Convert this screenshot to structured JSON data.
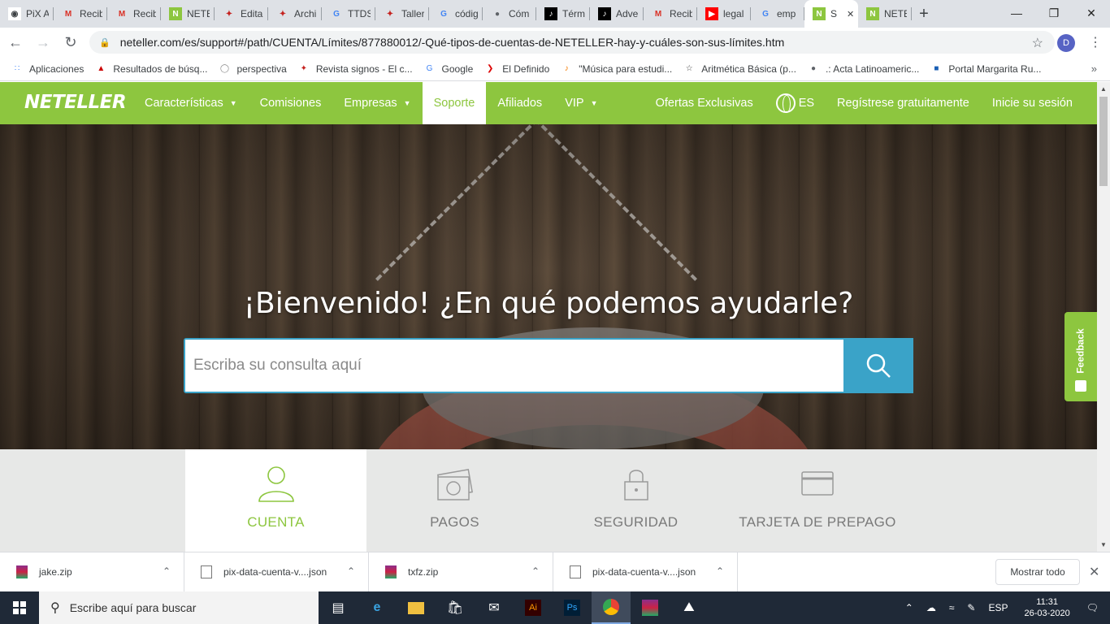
{
  "browser": {
    "tabs": [
      {
        "title": "PiX A",
        "icon": "pix-icon",
        "active": false
      },
      {
        "title": "Recib",
        "icon": "gmail-icon",
        "active": false
      },
      {
        "title": "Recib",
        "icon": "gmail-icon",
        "active": false
      },
      {
        "title": "NETE",
        "icon": "neteller-icon",
        "active": false
      },
      {
        "title": "Edita",
        "icon": "bird-icon",
        "active": false
      },
      {
        "title": "Archi",
        "icon": "bird-icon",
        "active": false
      },
      {
        "title": "TTDS",
        "icon": "google-icon",
        "active": false
      },
      {
        "title": "Taller",
        "icon": "bird-icon",
        "active": false
      },
      {
        "title": "códig",
        "icon": "google-icon",
        "active": false
      },
      {
        "title": "Cóm",
        "icon": "globe-icon",
        "active": false
      },
      {
        "title": "Térm",
        "icon": "tiktok-icon",
        "active": false
      },
      {
        "title": "Adve",
        "icon": "tiktok-icon",
        "active": false
      },
      {
        "title": "Recib",
        "icon": "gmail-icon",
        "active": false
      },
      {
        "title": "legal",
        "icon": "youtube-icon",
        "active": false
      },
      {
        "title": "emp",
        "icon": "google-icon",
        "active": false
      },
      {
        "title": "S",
        "icon": "neteller-icon",
        "active": true
      },
      {
        "title": "NETE",
        "icon": "neteller-icon",
        "active": false
      }
    ],
    "url": "neteller.com/es/support#/path/CUENTA/Límites/877880012/-Qué-tipos-de-cuentas-de-NETELLER-hay-y-cuáles-son-sus-límites.htm",
    "profile_initial": "D",
    "bookmarks": [
      {
        "label": "Aplicaciones",
        "icon": "apps-grid-icon"
      },
      {
        "label": "Resultados de búsq...",
        "icon": "adobe-icon"
      },
      {
        "label": "perspectiva",
        "icon": "bulb-icon"
      },
      {
        "label": "Revista signos - El c...",
        "icon": "bird-icon"
      },
      {
        "label": "Google",
        "icon": "google-icon"
      },
      {
        "label": "El Definido",
        "icon": "arrow-icon"
      },
      {
        "label": "\"Música para estudi...",
        "icon": "music-icon"
      },
      {
        "label": "Aritmética Básica (p...",
        "icon": "math-icon"
      },
      {
        "label": ".: Acta Latinoameric...",
        "icon": "globe-icon"
      },
      {
        "label": "Portal Margarita Ru...",
        "icon": "flag-icon"
      }
    ]
  },
  "site": {
    "brand": "NETELLER",
    "nav": [
      {
        "label": "Características",
        "dropdown": true,
        "active": false
      },
      {
        "label": "Comisiones",
        "dropdown": false,
        "active": false
      },
      {
        "label": "Empresas",
        "dropdown": true,
        "active": false
      },
      {
        "label": "Soporte",
        "dropdown": false,
        "active": true
      },
      {
        "label": "Afiliados",
        "dropdown": false,
        "active": false
      },
      {
        "label": "VIP",
        "dropdown": true,
        "active": false
      }
    ],
    "nav_right": {
      "offers": "Ofertas Exclusivas",
      "language": "ES",
      "register": "Regístrese gratuitamente",
      "login": "Inicie su sesión"
    },
    "hero": {
      "title": "¡Bienvenido! ¿En qué podemos ayudarle?",
      "search_placeholder": "Escriba su consulta aquí"
    },
    "feedback_label": "Feedback",
    "categories": [
      {
        "label": "CUENTA",
        "icon": "user-icon",
        "active": true
      },
      {
        "label": "PAGOS",
        "icon": "money-icon",
        "active": false
      },
      {
        "label": "SEGURIDAD",
        "icon": "lock-icon",
        "active": false
      },
      {
        "label": "TARJETA DE PREPAGO",
        "icon": "card-icon",
        "active": false
      }
    ],
    "colors": {
      "brand_green": "#8dc63f",
      "search_blue": "#3aa3c8"
    }
  },
  "downloads": {
    "items": [
      {
        "name": "jake.zip",
        "icon": "winrar-icon"
      },
      {
        "name": "pix-data-cuenta-v....json",
        "icon": "file-icon"
      },
      {
        "name": "txfz.zip",
        "icon": "winrar-icon"
      },
      {
        "name": "pix-data-cuenta-v....json",
        "icon": "file-icon"
      }
    ],
    "show_all": "Mostrar todo"
  },
  "taskbar": {
    "search_placeholder": "Escribe aquí para buscar",
    "language": "ESP",
    "time": "11:31",
    "date": "26-03-2020"
  }
}
